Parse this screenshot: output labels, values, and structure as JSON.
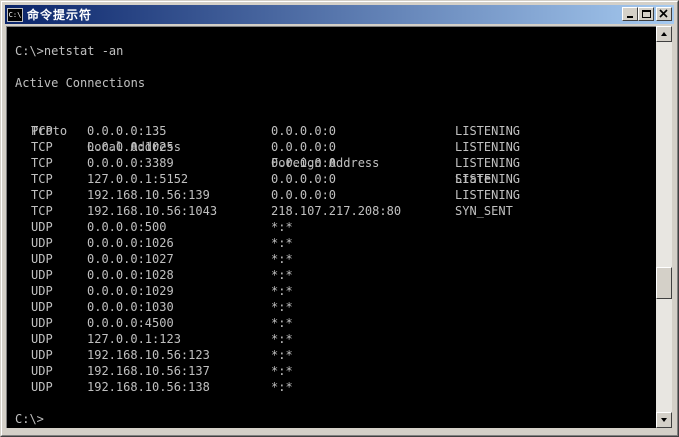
{
  "window": {
    "title": "命令提示符",
    "icon_label": "C:\\"
  },
  "console": {
    "command_line": "C:\\>netstat -an",
    "heading": "Active Connections",
    "columns": {
      "proto": "Proto",
      "local": "Local Address",
      "foreign": "Foreign Address",
      "state": "State"
    },
    "rows": [
      {
        "proto": "TCP",
        "local": "0.0.0.0:135",
        "foreign": "0.0.0.0:0",
        "state": "LISTENING"
      },
      {
        "proto": "TCP",
        "local": "0.0.0.0:1025",
        "foreign": "0.0.0.0:0",
        "state": "LISTENING"
      },
      {
        "proto": "TCP",
        "local": "0.0.0.0:3389",
        "foreign": "0.0.0.0:0",
        "state": "LISTENING"
      },
      {
        "proto": "TCP",
        "local": "127.0.0.1:5152",
        "foreign": "0.0.0.0:0",
        "state": "LISTENING"
      },
      {
        "proto": "TCP",
        "local": "192.168.10.56:139",
        "foreign": "0.0.0.0:0",
        "state": "LISTENING"
      },
      {
        "proto": "TCP",
        "local": "192.168.10.56:1043",
        "foreign": "218.107.217.208:80",
        "state": "SYN_SENT"
      },
      {
        "proto": "UDP",
        "local": "0.0.0.0:500",
        "foreign": "*:*",
        "state": ""
      },
      {
        "proto": "UDP",
        "local": "0.0.0.0:1026",
        "foreign": "*:*",
        "state": ""
      },
      {
        "proto": "UDP",
        "local": "0.0.0.0:1027",
        "foreign": "*:*",
        "state": ""
      },
      {
        "proto": "UDP",
        "local": "0.0.0.0:1028",
        "foreign": "*:*",
        "state": ""
      },
      {
        "proto": "UDP",
        "local": "0.0.0.0:1029",
        "foreign": "*:*",
        "state": ""
      },
      {
        "proto": "UDP",
        "local": "0.0.0.0:1030",
        "foreign": "*:*",
        "state": ""
      },
      {
        "proto": "UDP",
        "local": "0.0.0.0:4500",
        "foreign": "*:*",
        "state": ""
      },
      {
        "proto": "UDP",
        "local": "127.0.0.1:123",
        "foreign": "*:*",
        "state": ""
      },
      {
        "proto": "UDP",
        "local": "192.168.10.56:123",
        "foreign": "*:*",
        "state": ""
      },
      {
        "proto": "UDP",
        "local": "192.168.10.56:137",
        "foreign": "*:*",
        "state": ""
      },
      {
        "proto": "UDP",
        "local": "192.168.10.56:138",
        "foreign": "*:*",
        "state": ""
      }
    ],
    "prompt": "C:\\>"
  },
  "colors": {
    "console_background": "#000000",
    "console_text": "#c0c0c0",
    "title_gradient_start": "#0a246a",
    "title_gradient_end": "#a6caf0"
  },
  "icons": {
    "app": "console-icon",
    "minimize": "minimize-icon",
    "maximize": "maximize-icon",
    "close": "close-icon",
    "scroll_up": "scroll-up-arrow-icon",
    "scroll_down": "scroll-down-arrow-icon"
  }
}
